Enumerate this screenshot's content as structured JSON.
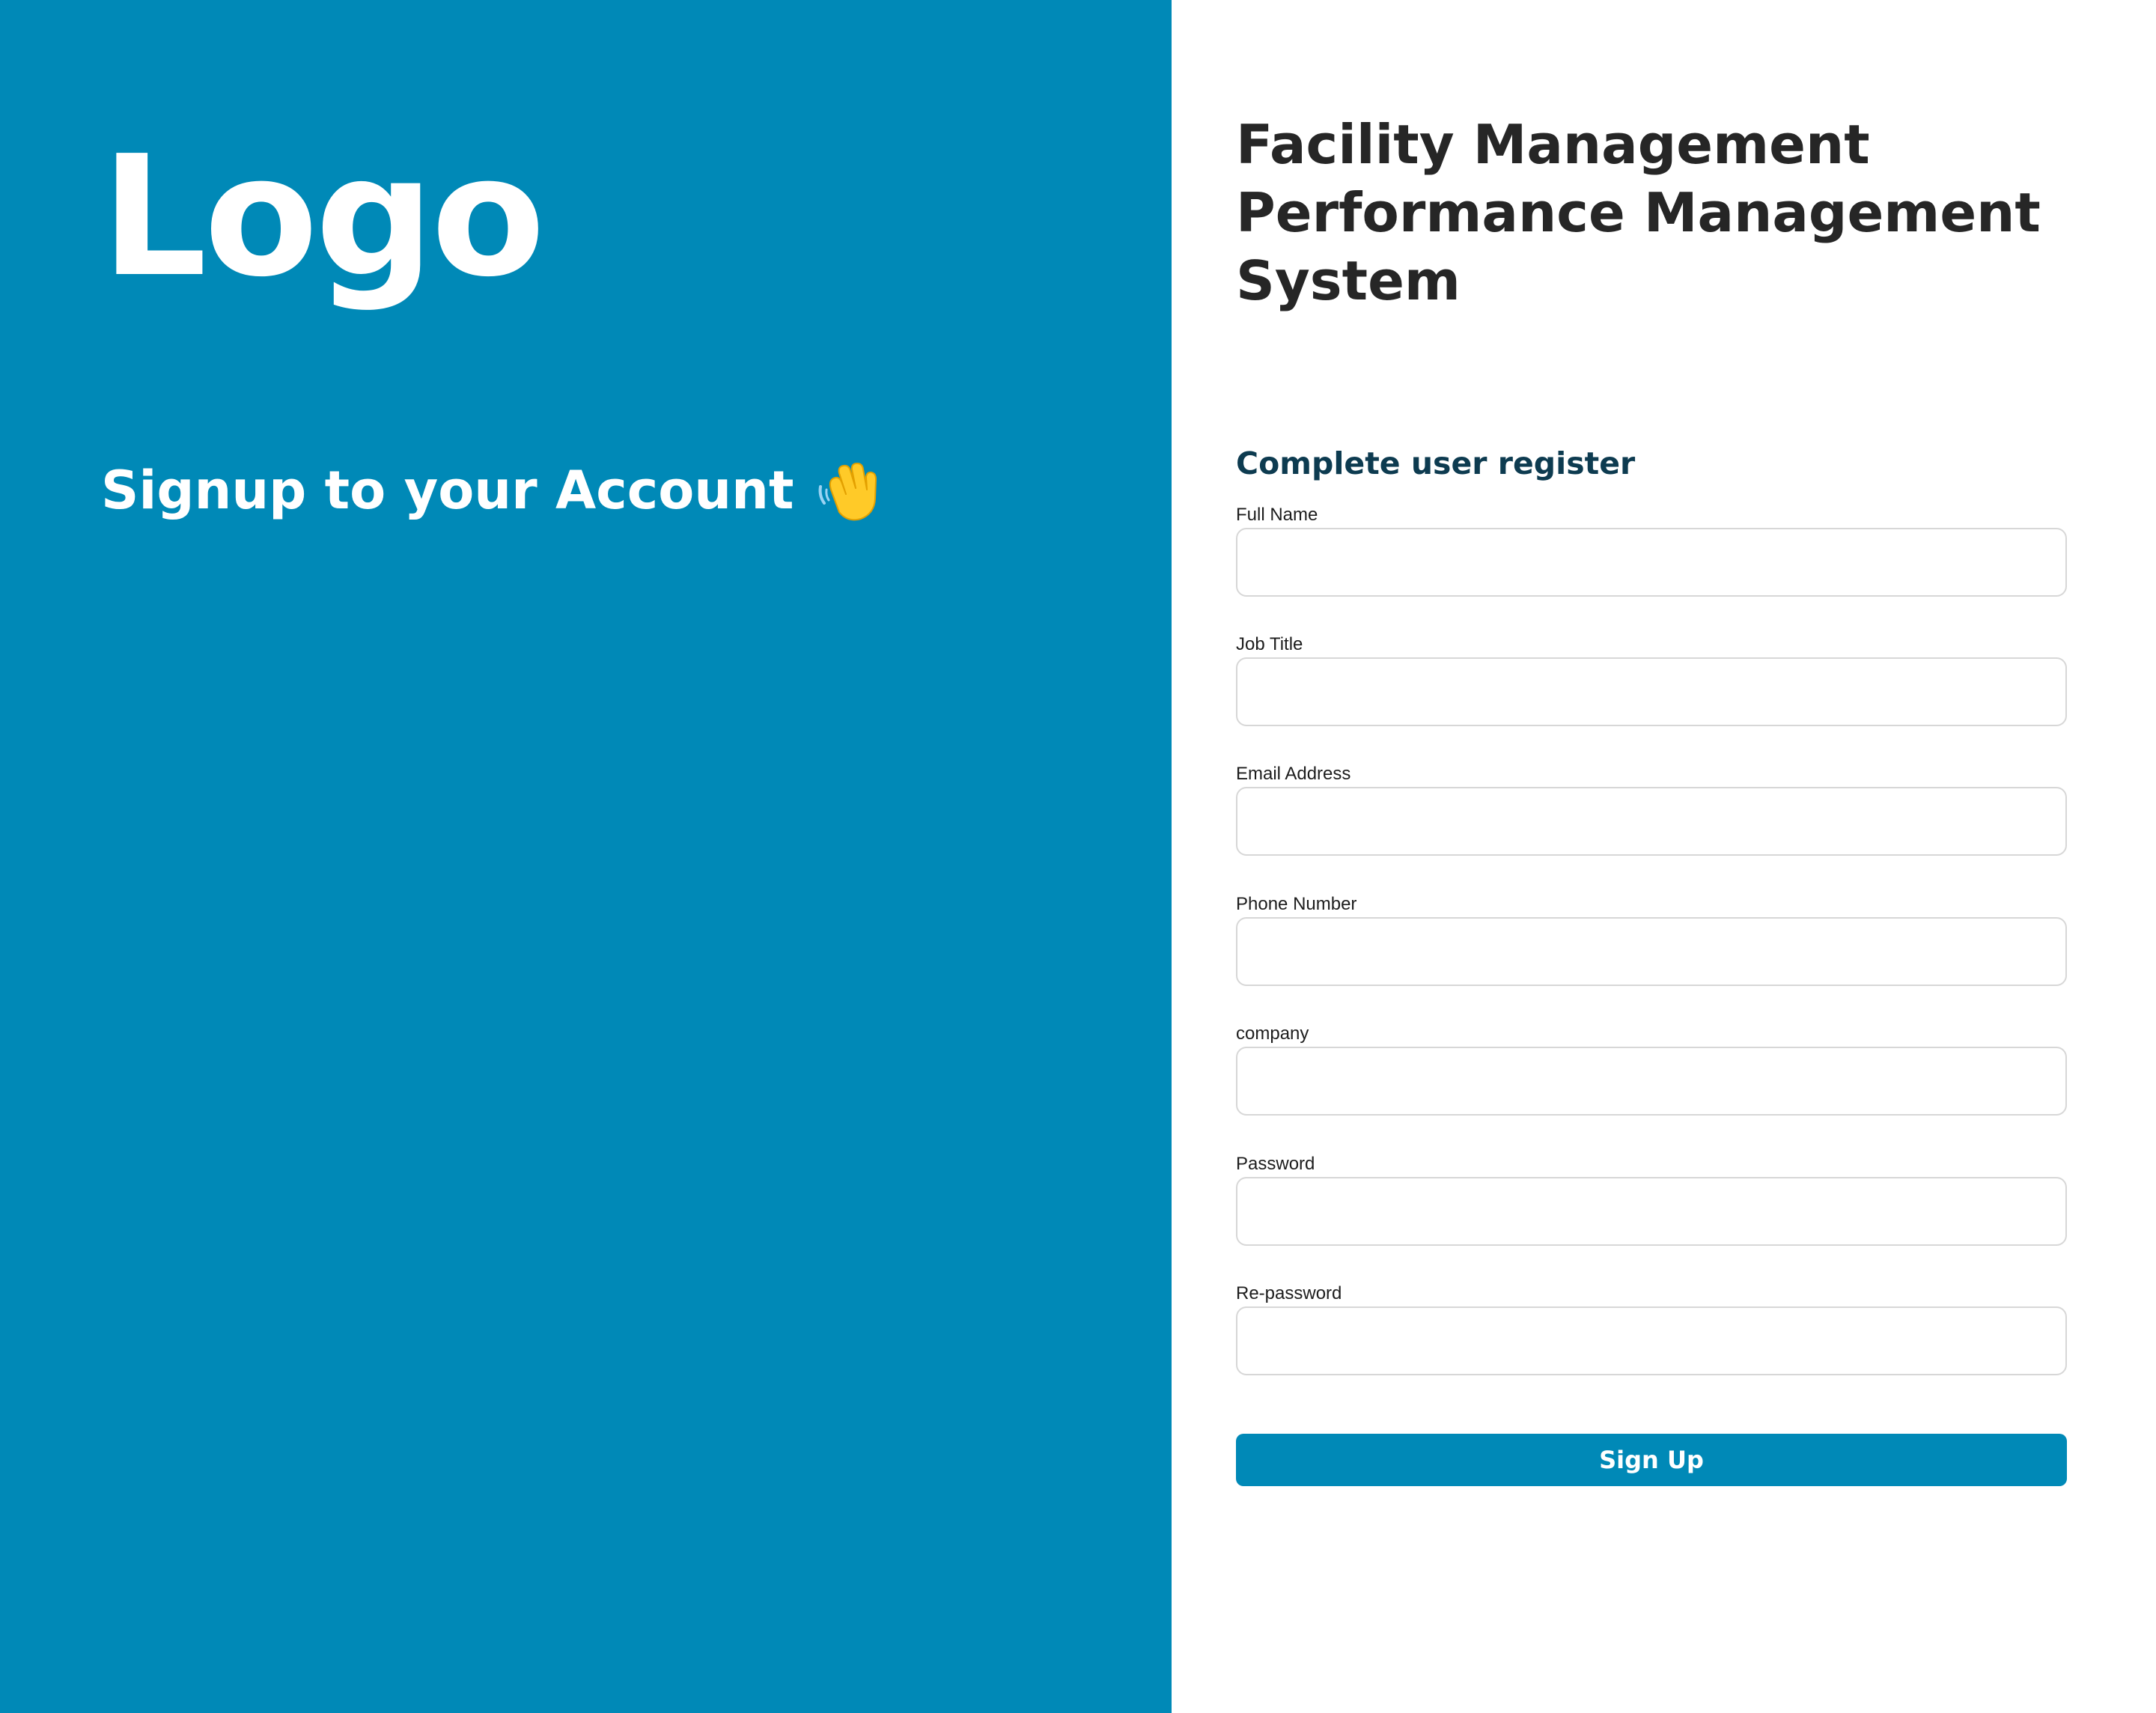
{
  "brand": {
    "logo_text": "Logo",
    "welcome_text": "Signup to your Account",
    "welcome_icon": "waving-hand-icon",
    "panel_color": "#0089b7"
  },
  "app": {
    "title": "Facility Management Performance Management System"
  },
  "form": {
    "heading": "Complete user register",
    "fields": [
      {
        "label": "Full Name",
        "value": "",
        "placeholder": ""
      },
      {
        "label": "Job Title",
        "value": "",
        "placeholder": ""
      },
      {
        "label": "Email Address",
        "value": "",
        "placeholder": ""
      },
      {
        "label": "Phone Number",
        "value": "",
        "placeholder": ""
      },
      {
        "label": "company",
        "value": "",
        "placeholder": ""
      },
      {
        "label": "Password",
        "value": "",
        "placeholder": ""
      },
      {
        "label": "Re-password",
        "value": "",
        "placeholder": ""
      }
    ],
    "submit_label": "Sign Up",
    "button_color": "#0089b7"
  }
}
